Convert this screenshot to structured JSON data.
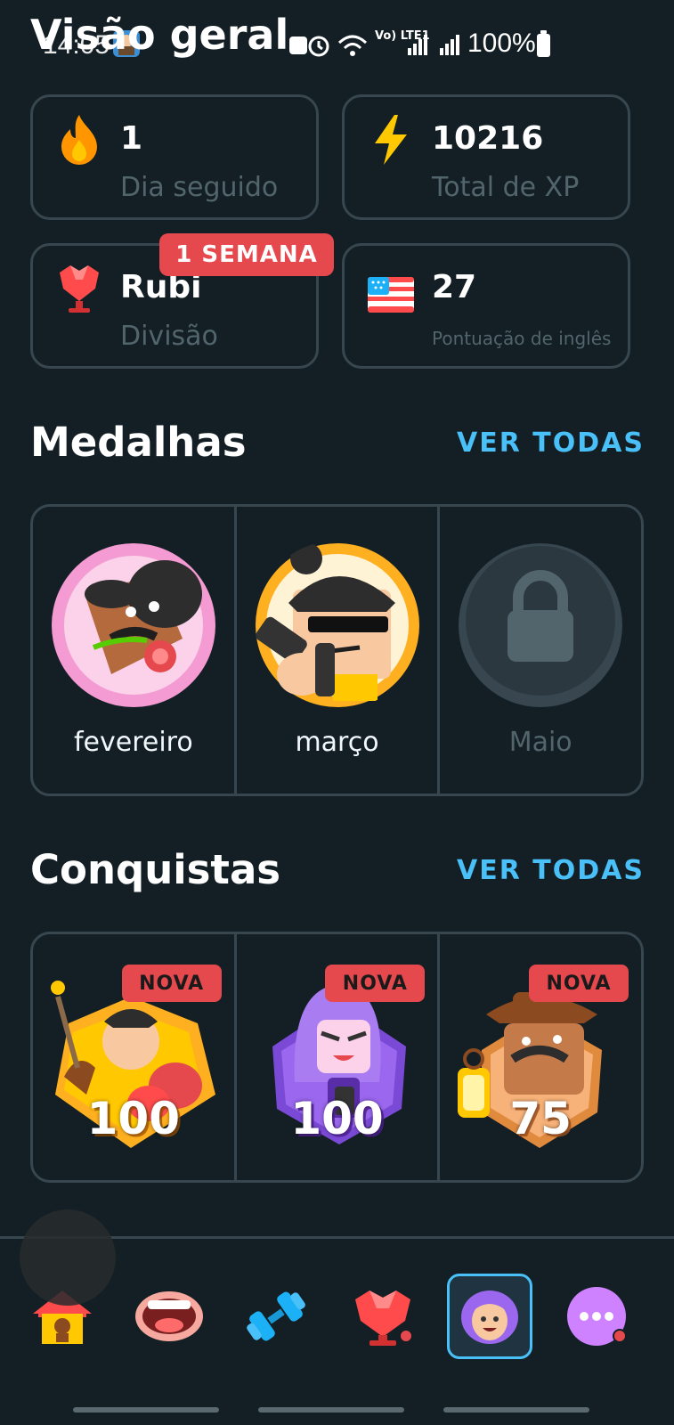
{
  "status_bar": {
    "time": "14:05",
    "battery": "100%",
    "network": "Vo) LTE1"
  },
  "page_title": "Visão geral",
  "stats": [
    {
      "value": "1",
      "label": "Dia seguido",
      "icon": "flame-icon"
    },
    {
      "value": "10216",
      "label": "Total de XP",
      "icon": "lightning-icon"
    },
    {
      "value": "Rubi",
      "label": "Divisão",
      "icon": "ruby-trophy-icon",
      "badge": "1 SEMANA"
    },
    {
      "value": "27",
      "label": "Pontuação de inglês",
      "icon": "us-flag-icon"
    }
  ],
  "medals": {
    "title": "Medalhas",
    "see_all": "VER TODAS",
    "items": [
      {
        "label": "fevereiro",
        "locked": false
      },
      {
        "label": "março",
        "locked": false
      },
      {
        "label": "Maio",
        "locked": true
      }
    ]
  },
  "achievements": {
    "title": "Conquistas",
    "see_all": "VER TODAS",
    "items": [
      {
        "badge": "NOVA",
        "number": "100"
      },
      {
        "badge": "NOVA",
        "number": "100"
      },
      {
        "badge": "NOVA",
        "number": "75"
      }
    ]
  },
  "nav": [
    "home-icon",
    "speak-icon",
    "practice-dumbbell-icon",
    "leagues-icon",
    "profile-icon",
    "more-icon"
  ],
  "colors": {
    "background": "#131f24",
    "border": "#37464f",
    "accent_blue": "#49c0f8",
    "badge_red": "#e5484d",
    "muted_text": "#52656d"
  }
}
